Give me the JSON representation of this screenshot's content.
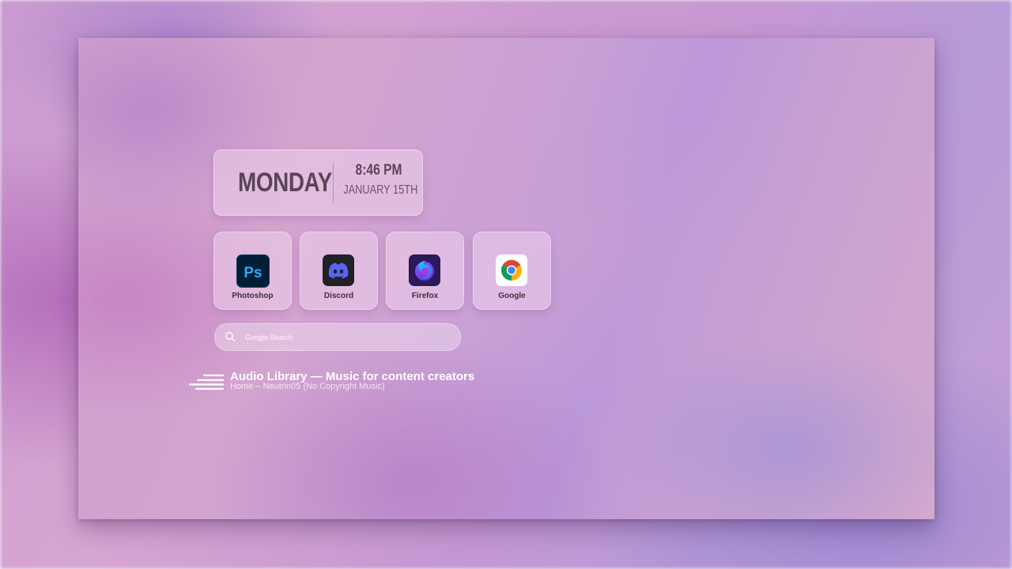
{
  "clock": {
    "day": "MONDAY",
    "time": "8:46 PM",
    "date": "JANUARY 15TH"
  },
  "apps": [
    {
      "label": "Photoshop",
      "icon": "photoshop-icon"
    },
    {
      "label": "Discord",
      "icon": "discord-icon"
    },
    {
      "label": "Firefox",
      "icon": "firefox-icon"
    },
    {
      "label": "Google",
      "icon": "chrome-icon"
    }
  ],
  "search": {
    "placeholder": "Google Search",
    "icon": "search-icon"
  },
  "audio_credit": {
    "title": "Audio Library — Music for content creators",
    "subtitle": "Home – Neutrin05 (No Copyright Music)"
  },
  "colors": {
    "text_dark": "#5a4556",
    "photoshop_bg": "#001e36",
    "photoshop_accent": "#31a8ff",
    "discord_bg": "#202225",
    "discord_accent": "#5865f2",
    "firefox_bg": "#2b1a5a"
  }
}
